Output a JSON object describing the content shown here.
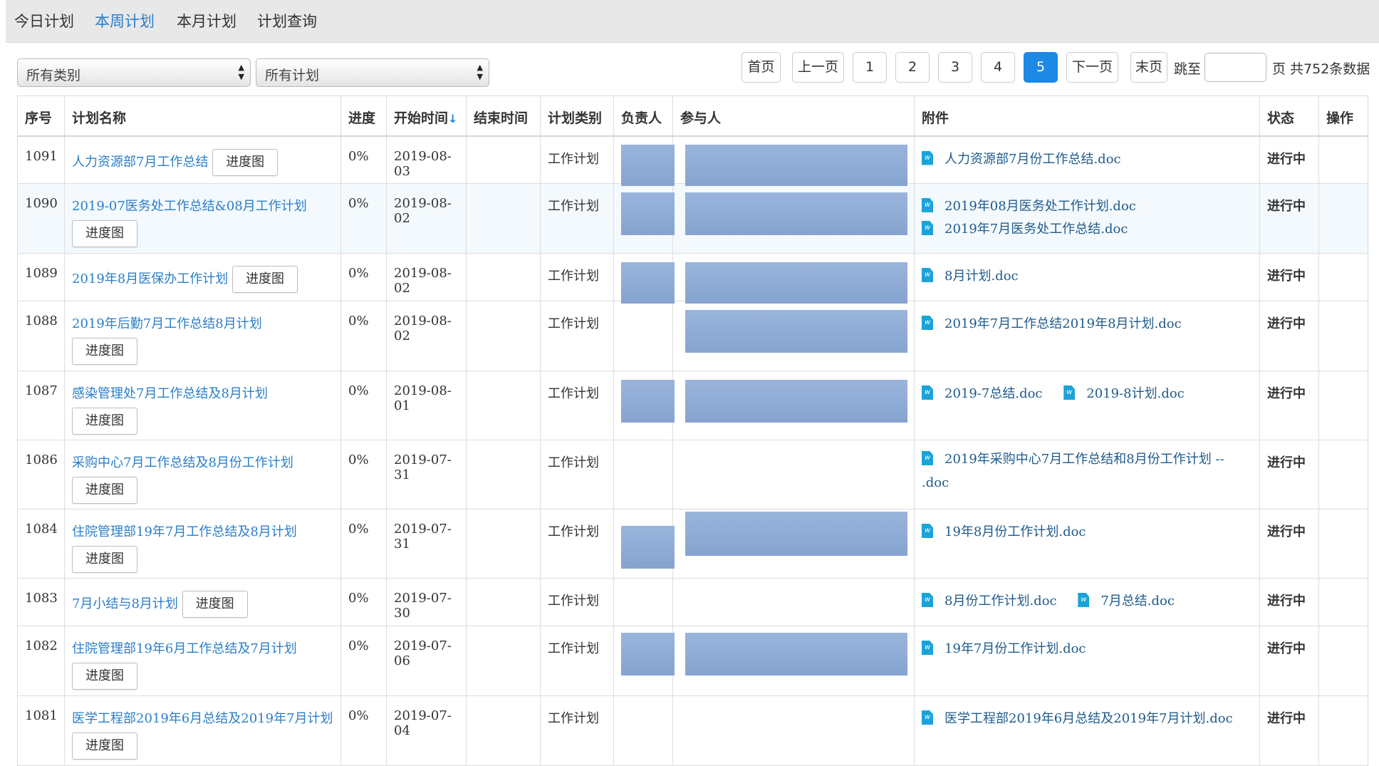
{
  "nav": {
    "tabs": [
      {
        "label": "今日计划",
        "active": false
      },
      {
        "label": "本周计划",
        "active": true
      },
      {
        "label": "本月计划",
        "active": false
      },
      {
        "label": "计划查询",
        "active": false
      }
    ]
  },
  "filters": {
    "category": "所有类别",
    "plan": "所有计划"
  },
  "pagination": {
    "first": "首页",
    "prev": "上一页",
    "pages": [
      "1",
      "2",
      "3",
      "4",
      "5"
    ],
    "current_page": "5",
    "next": "下一页",
    "last": "末页",
    "jump_to": "跳至",
    "page_suffix": "页 共752条数据"
  },
  "table": {
    "headers": {
      "no": "序号",
      "name": "计划名称",
      "progress": "进度",
      "start": "开始时间",
      "start_sort_arrow": "↓",
      "end": "结束时间",
      "type": "计划类别",
      "owner": "负责人",
      "participants": "参与人",
      "attachments": "附件",
      "status": "状态",
      "action": "操作"
    },
    "progress_button": "进度图",
    "rows": [
      {
        "no": "1091",
        "name": "人力资源部7月工作总结",
        "progress": "0%",
        "start": "2019-08-03",
        "end": "",
        "type": "工作计划",
        "attachments": [
          "人力资源部7月份工作总结.doc"
        ],
        "status": "进行中"
      },
      {
        "no": "1090",
        "name": "2019-07医务处工作总结&08月工作计划",
        "progress": "0%",
        "start": "2019-08-02",
        "end": "",
        "type": "工作计划",
        "attachments": [
          "2019年08月医务处工作计划.doc",
          "2019年7月医务处工作总结.doc"
        ],
        "status": "进行中"
      },
      {
        "no": "1089",
        "name": "2019年8月医保办工作计划",
        "progress": "0%",
        "start": "2019-08-02",
        "end": "",
        "type": "工作计划",
        "attachments": [
          "8月计划.doc"
        ],
        "status": "进行中"
      },
      {
        "no": "1088",
        "name": "2019年后勤7月工作总结8月计划",
        "progress": "0%",
        "start": "2019-08-02",
        "end": "",
        "type": "工作计划",
        "attachments": [
          "2019年7月工作总结2019年8月计划.doc"
        ],
        "status": "进行中"
      },
      {
        "no": "1087",
        "name": "感染管理处7月工作总结及8月计划",
        "progress": "0%",
        "start": "2019-08-01",
        "end": "",
        "type": "工作计划",
        "attachments": [
          "2019-7总结.doc",
          "2019-8计划.doc"
        ],
        "status": "进行中"
      },
      {
        "no": "1086",
        "name": "采购中心7月工作总结及8月份工作计划",
        "progress": "0%",
        "start": "2019-07-31",
        "end": "",
        "type": "工作计划",
        "attachments": [
          "2019年采购中心7月工作总结和8月份工作计划 -- .doc"
        ],
        "status": "进行中"
      },
      {
        "no": "1084",
        "name": "住院管理部19年7月工作总结及8月计划",
        "progress": "0%",
        "start": "2019-07-31",
        "end": "",
        "type": "工作计划",
        "attachments": [
          "19年8月份工作计划.doc"
        ],
        "status": "进行中"
      },
      {
        "no": "1083",
        "name": "7月小结与8月计划",
        "progress": "0%",
        "start": "2019-07-30",
        "end": "",
        "type": "工作计划",
        "attachments": [
          "8月份工作计划.doc",
          "7月总结.doc"
        ],
        "status": "进行中"
      },
      {
        "no": "1082",
        "name": "住院管理部19年6月工作总结及7月计划",
        "progress": "0%",
        "start": "2019-07-06",
        "end": "",
        "type": "工作计划",
        "attachments": [
          "19年7月份工作计划.doc"
        ],
        "status": "进行中"
      },
      {
        "no": "1081",
        "name": "医学工程部2019年6月总结及2019年7月计划",
        "progress": "0%",
        "start": "2019-07-04",
        "end": "",
        "type": "工作计划",
        "attachments": [
          "医学工程部2019年6月总结及2019年7月计划.doc"
        ],
        "status": "进行中"
      }
    ]
  },
  "colors": {
    "accent": "#1e88e5",
    "link": "#2a7ec9",
    "status_green": "#2aa52a",
    "redaction": "#8eaad3"
  },
  "icons": {
    "attachment": "word-doc-icon",
    "select_arrow": "updown-caret-icon"
  }
}
